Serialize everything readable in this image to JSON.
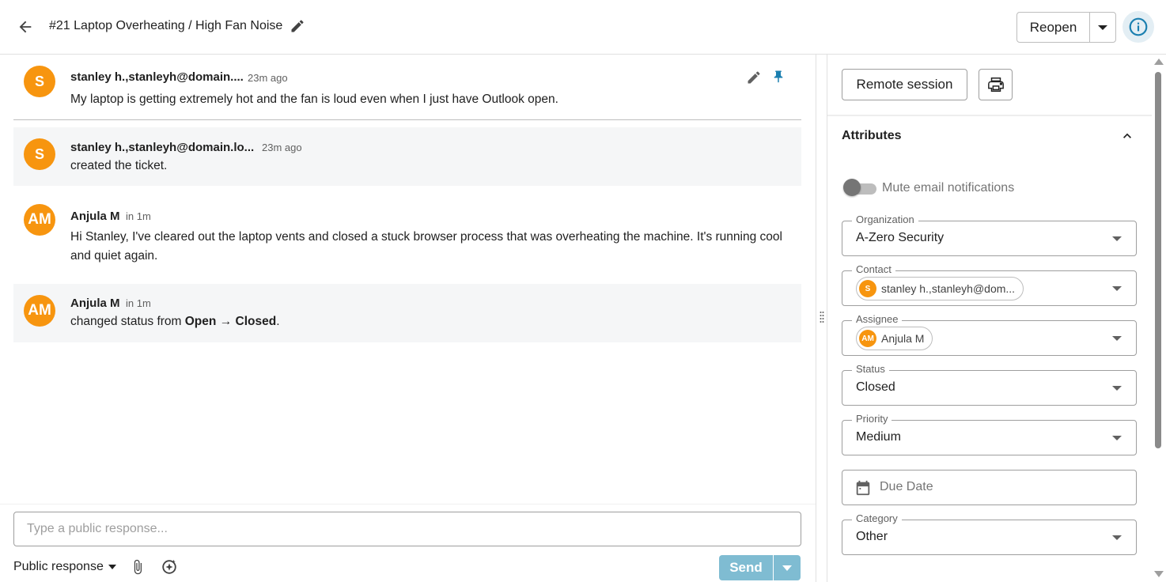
{
  "header": {
    "title": "#21 Laptop Overheating / High Fan Noise",
    "reopen_label": "Reopen"
  },
  "messages": [
    {
      "avatar": "S",
      "author": "stanley h.,stanleyh@domain....",
      "time": "23m ago",
      "body": "My laptop is getting extremely hot and the fan is loud even when I just have Outlook open."
    },
    {
      "avatar": "S",
      "author": "stanley h.,stanleyh@domain.lo...",
      "time": "23m ago",
      "body": "created the ticket."
    },
    {
      "avatar": "AM",
      "author": "Anjula M",
      "time": "in 1m",
      "body": "Hi Stanley, I've cleared out the laptop vents and closed a stuck browser process that was overheating the machine. It's running cool and quiet again."
    },
    {
      "avatar": "AM",
      "author": "Anjula M",
      "time": "in 1m",
      "body_prefix": "changed status from ",
      "status_from": "Open",
      "arrow": "→",
      "status_to": "Closed",
      "body_suffix": "."
    }
  ],
  "composer": {
    "placeholder": "Type a public response...",
    "response_type": "Public response",
    "send_label": "Send"
  },
  "sidebar": {
    "remote_session_label": "Remote session",
    "attributes_title": "Attributes",
    "mute_label": "Mute email notifications",
    "mute_enabled": false,
    "fields": {
      "organization": {
        "label": "Organization",
        "value": "A-Zero Security"
      },
      "contact": {
        "label": "Contact",
        "avatar": "S",
        "value": "stanley h.,stanleyh@dom..."
      },
      "assignee": {
        "label": "Assignee",
        "avatar": "AM",
        "value": "Anjula M"
      },
      "status": {
        "label": "Status",
        "value": "Closed"
      },
      "priority": {
        "label": "Priority",
        "value": "Medium"
      },
      "due_date": {
        "placeholder": "Due Date"
      },
      "category": {
        "label": "Category",
        "value": "Other"
      }
    }
  },
  "colors": {
    "avatar": "#f7950f",
    "accent": "#1976d2",
    "pin": "#1a7fb0",
    "send_disabled": "#7fbcd2"
  },
  "icons": {
    "back": "arrow-left-icon",
    "edit": "pencil-icon",
    "pin": "pin-icon",
    "info": "info-icon",
    "print": "printer-icon",
    "attach": "paperclip-icon",
    "ai": "sparkle-icon",
    "calendar": "calendar-icon"
  }
}
